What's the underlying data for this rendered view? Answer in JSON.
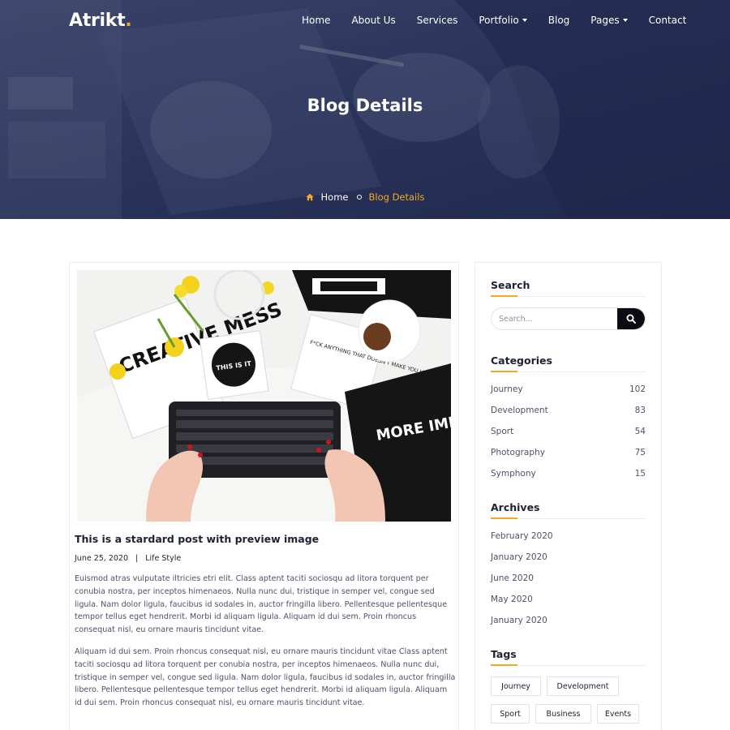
{
  "header": {
    "logo_text": "Atrikt",
    "logo_dot": ".",
    "nav": [
      {
        "label": "Home",
        "dropdown": false
      },
      {
        "label": "About Us",
        "dropdown": false
      },
      {
        "label": "Services",
        "dropdown": false
      },
      {
        "label": "Portfolio",
        "dropdown": true
      },
      {
        "label": "Blog",
        "dropdown": false
      },
      {
        "label": "Pages",
        "dropdown": true
      },
      {
        "label": "Contact",
        "dropdown": false
      }
    ]
  },
  "hero": {
    "title": "Blog Details",
    "breadcrumb": {
      "home": "Home",
      "current": "Blog Details"
    }
  },
  "post": {
    "image_text": {
      "creative_mess": "CREATIVE MESS",
      "this_is_it": "THIS IS IT",
      "more_important": "MORE IMPORTANT",
      "doesnt": "F*CK ANYTHING THAT DOESN'T MAKE YOU HAPPY"
    },
    "title": "This is a stardard post with preview image",
    "date": "June 25, 2020",
    "separator": "|",
    "category": "Life Style",
    "paragraphs": [
      "Euismod atras vulputate iltricies etri elit. Class aptent taciti sociosqu ad litora torquent per conubia nostra, per inceptos himenaeos. Nulla nunc dui, tristique in semper vel, congue sed ligula. Nam dolor ligula, faucibus id sodales in, auctor fringilla libero. Pellentesque pellentesque tempor tellus eget hendrerit. Morbi id aliquam ligula. Aliquam id dui sem. Proin rhoncus consequat nisl, eu ornare mauris tincidunt vitae.",
      "Aliquam id dui sem. Proin rhoncus consequat nisl, eu ornare mauris tincidunt vitae Class aptent taciti sociosqu ad litora torquent per conubia nostra, per inceptos himenaeos. Nulla nunc dui, tristique in semper vel, congue sed ligula. Nam dolor ligula, faucibus id sodales in, auctor fringilla libero. Pellentesque pellentesque tempor tellus eget hendrerit. Morbi id aliquam ligula. Aliquam id dui sem. Proin rhoncus consequat nisl, eu ornare mauris tincidunt vitae."
    ]
  },
  "sidebar": {
    "search": {
      "title": "Search",
      "placeholder": "Search..."
    },
    "categories": {
      "title": "Categories",
      "items": [
        {
          "label": "Journey",
          "count": "102"
        },
        {
          "label": "Development",
          "count": "83"
        },
        {
          "label": "Sport",
          "count": "54"
        },
        {
          "label": "Photography",
          "count": "75"
        },
        {
          "label": "Symphony",
          "count": "15"
        }
      ]
    },
    "archives": {
      "title": "Archives",
      "items": [
        "February 2020",
        "January 2020",
        "June 2020",
        "May 2020",
        "January 2020"
      ]
    },
    "tags": {
      "title": "Tags",
      "items": [
        "Journey",
        "Development",
        "Sport",
        "Business",
        "Events"
      ]
    }
  },
  "colors": {
    "accent": "#f6a823",
    "hero_overlay": "#1e264c",
    "heading": "#1d2233",
    "body_text": "#4c5266",
    "search_button": "#0b0b12"
  },
  "icons": [
    "home-icon",
    "search-icon",
    "chevron-down-icon"
  ]
}
